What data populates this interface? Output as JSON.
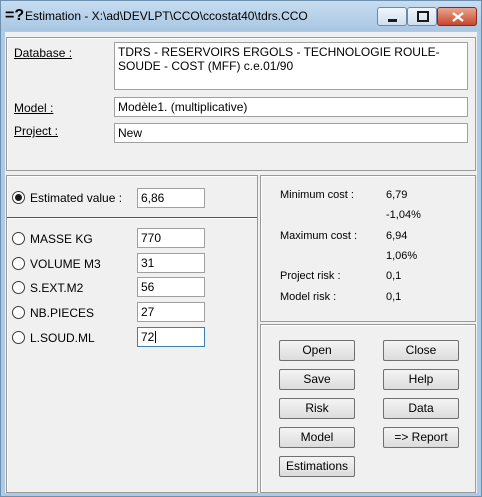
{
  "window": {
    "icon_text": "=?",
    "title": "Estimation - X:\\ad\\DEVLPT\\CCO\\ccostat40\\tdrs.CCO"
  },
  "header": {
    "database_label": "Database :",
    "database_value": "TDRS - RESERVOIRS ERGOLS - TECHNOLOGIE ROULE-SOUDE - COST (MFF) c.e.01/90",
    "model_label": "Model :",
    "model_value": "Modèle1. (multiplicative)",
    "project_label": "Project :",
    "project_value": "New"
  },
  "estimate": {
    "label": "Estimated value :",
    "value": "6,86"
  },
  "parameters": [
    {
      "label": "MASSE KG",
      "value": "770"
    },
    {
      "label": "VOLUME M3",
      "value": "31"
    },
    {
      "label": "S.EXT.M2",
      "value": "56"
    },
    {
      "label": "NB.PIECES",
      "value": "27"
    },
    {
      "label": "L.SOUD.ML",
      "value": "72"
    }
  ],
  "stats": {
    "min_label": "Minimum cost :",
    "min_value": "6,79",
    "min_pct": "-1,04%",
    "max_label": "Maximum cost :",
    "max_value": "6,94",
    "max_pct": "1,06%",
    "project_risk_label": "Project risk :",
    "project_risk_value": "0,1",
    "model_risk_label": "Model risk :",
    "model_risk_value": "0,1"
  },
  "buttons": {
    "open": "Open",
    "close": "Close",
    "save": "Save",
    "help": "Help",
    "risk": "Risk",
    "data": "Data",
    "model": "Model",
    "report": "=> Report",
    "estimations": "Estimations"
  },
  "colors": {
    "title_bar": "#aecbe6",
    "close_button": "#c7462a",
    "dialog_bg": "#f0f0f0"
  }
}
